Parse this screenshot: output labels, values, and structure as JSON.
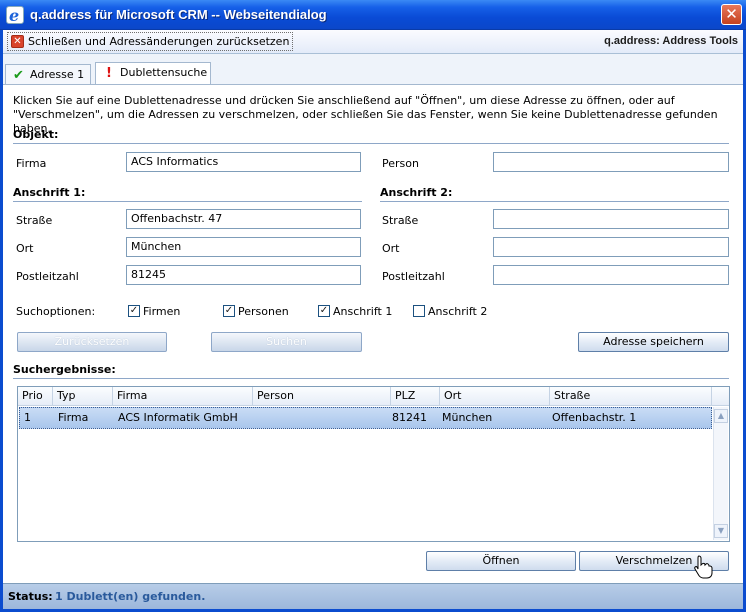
{
  "window": {
    "title": "q.address für Microsoft CRM -- Webseitendialog",
    "close": "✕"
  },
  "toolbar": {
    "reset_close_label": "Schließen und Adressänderungen zurücksetzen",
    "brand": "q.address: Address Tools"
  },
  "tabs": [
    {
      "label": "Adresse 1",
      "icon": "checkmark-icon",
      "active": false
    },
    {
      "label": "Dublettensuche",
      "icon": "exclamation-icon",
      "active": true
    }
  ],
  "intro": "Klicken Sie auf eine Dublettenadresse und drücken Sie anschließend auf \"Öffnen\", um diese Adresse zu öffnen, oder auf \"Verschmelzen\", um die Adressen zu verschmelzen, oder schließen Sie das Fenster, wenn Sie keine Dublettenadresse gefunden haben.",
  "objekt": {
    "heading": "Objekt:",
    "firma_label": "Firma",
    "firma_value": "ACS Informatics",
    "person_label": "Person",
    "person_value": ""
  },
  "anschrift1": {
    "heading": "Anschrift 1:",
    "strasse_label": "Straße",
    "strasse_value": "Offenbachstr. 47",
    "ort_label": "Ort",
    "ort_value": "München",
    "plz_label": "Postleitzahl",
    "plz_value": "81245"
  },
  "anschrift2": {
    "heading": "Anschrift 2:",
    "strasse_label": "Straße",
    "strasse_value": "",
    "ort_label": "Ort",
    "ort_value": "",
    "plz_label": "Postleitzahl",
    "plz_value": ""
  },
  "suchoptionen": {
    "label": "Suchoptionen:",
    "options": [
      {
        "label": "Firmen",
        "checked": true
      },
      {
        "label": "Personen",
        "checked": true
      },
      {
        "label": "Anschrift 1",
        "checked": true
      },
      {
        "label": "Anschrift 2",
        "checked": false
      }
    ]
  },
  "buttons": {
    "reset": "Zurücksetzen",
    "search": "Suchen",
    "save": "Adresse speichern",
    "open": "Öffnen",
    "merge": "Verschmelzen"
  },
  "results": {
    "heading": "Suchergebnisse:",
    "columns": [
      "Prio",
      "Typ",
      "Firma",
      "Person",
      "PLZ",
      "Ort",
      "Straße"
    ],
    "rows": [
      {
        "prio": "1",
        "typ": "Firma",
        "firma": "ACS Informatik GmbH",
        "person": "",
        "plz": "81241",
        "ort": "München",
        "strasse": "Offenbachstr. 1"
      }
    ]
  },
  "status": {
    "label": "Status:",
    "value": "1 Dublett(en) gefunden."
  }
}
